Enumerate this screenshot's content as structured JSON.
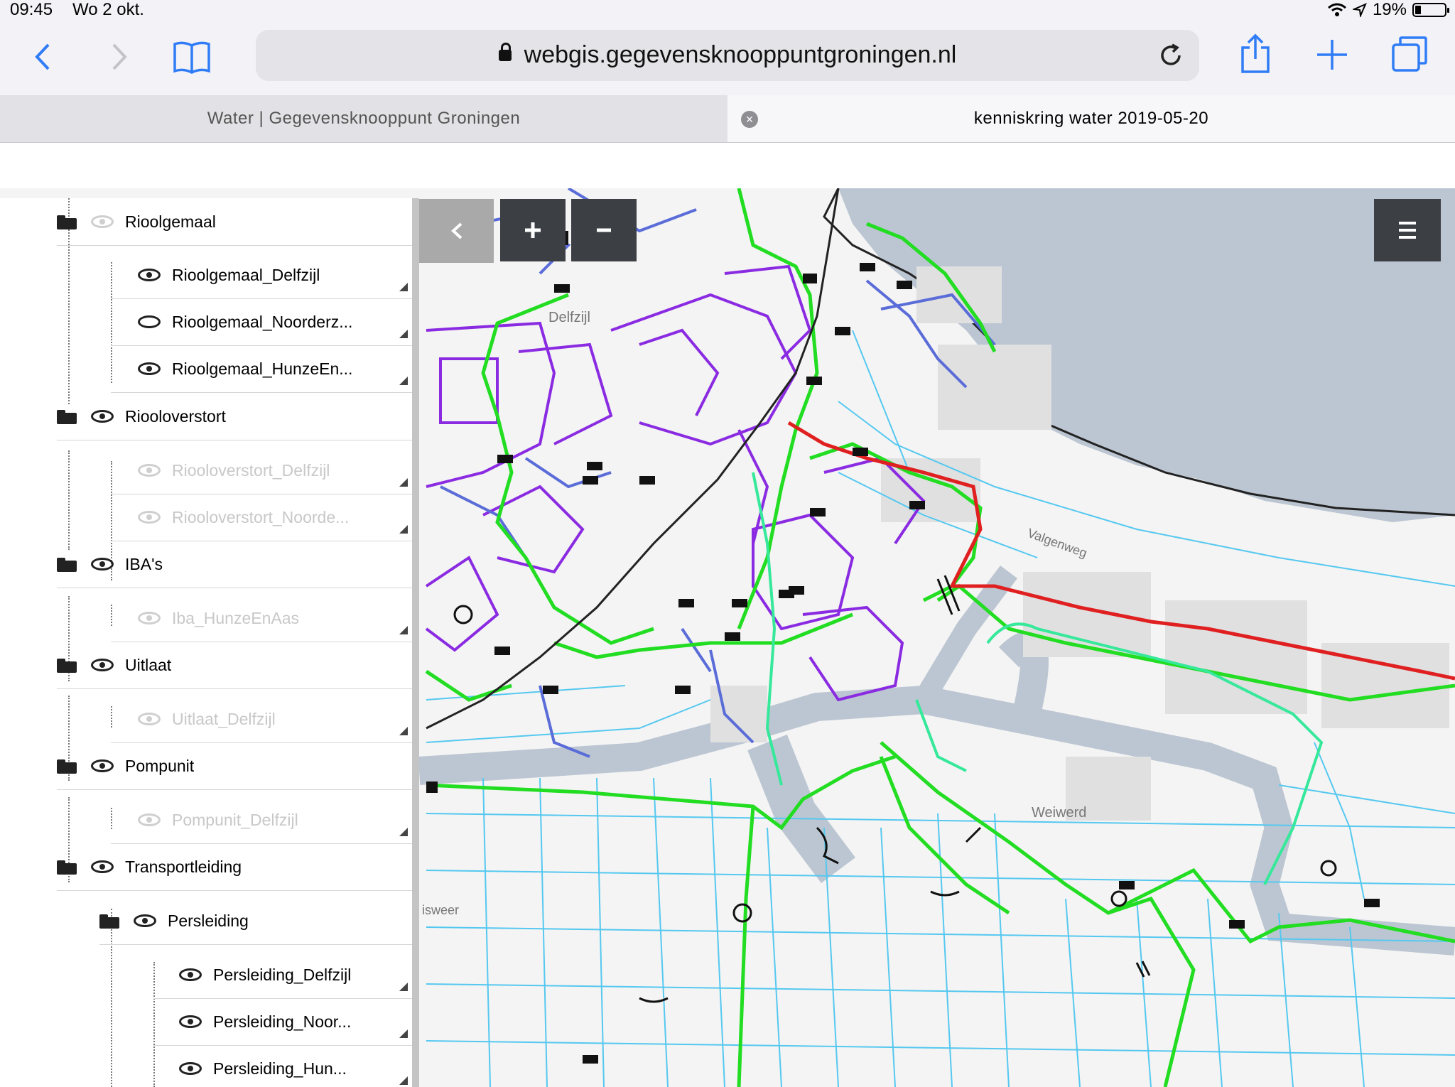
{
  "status": {
    "time": "09:45",
    "date": "Wo 2 okt.",
    "battery": "19%"
  },
  "browser": {
    "url": "webgis.gegevensknooppuntgroningen.nl",
    "tabs": [
      {
        "title": "Water | Gegevensknooppunt Groningen"
      },
      {
        "title": "kenniskring water 2019-05-20"
      }
    ]
  },
  "map": {
    "labels": {
      "delfzijl": "Delfzijl",
      "weiwerd": "Weiwerd",
      "valgenweg": "Valgenweg",
      "sweer": "isweer"
    },
    "colors": {
      "green": "#22dd22",
      "cyan": "#55c8f0",
      "purple": "#8a2be2",
      "blue": "#5a6cd8",
      "red": "#e02020",
      "water": "#bcc6d2"
    }
  },
  "layers": {
    "rioolgemaal": {
      "label": "Rioolgemaal",
      "children": [
        "Rioolgemaal_Delfzijl",
        "Rioolgemaal_Noorderz...",
        "Rioolgemaal_HunzeEn..."
      ]
    },
    "riooloverstort": {
      "label": "Riooloverstort",
      "children": [
        "Riooloverstort_Delfzijl",
        "Riooloverstort_Noorde..."
      ]
    },
    "iba": {
      "label": "IBA's",
      "children": [
        "Iba_HunzeEnAas"
      ]
    },
    "uitlaat": {
      "label": "Uitlaat",
      "children": [
        "Uitlaat_Delfzijl"
      ]
    },
    "pompunit": {
      "label": "Pompunit",
      "children": [
        "Pompunit_Delfzijl"
      ]
    },
    "transportleiding": {
      "label": "Transportleiding",
      "persleiding": {
        "label": "Persleiding",
        "children": [
          "Persleiding_Delfzijl",
          "Persleiding_Noor...",
          "Persleiding_Hun..."
        ]
      }
    }
  }
}
